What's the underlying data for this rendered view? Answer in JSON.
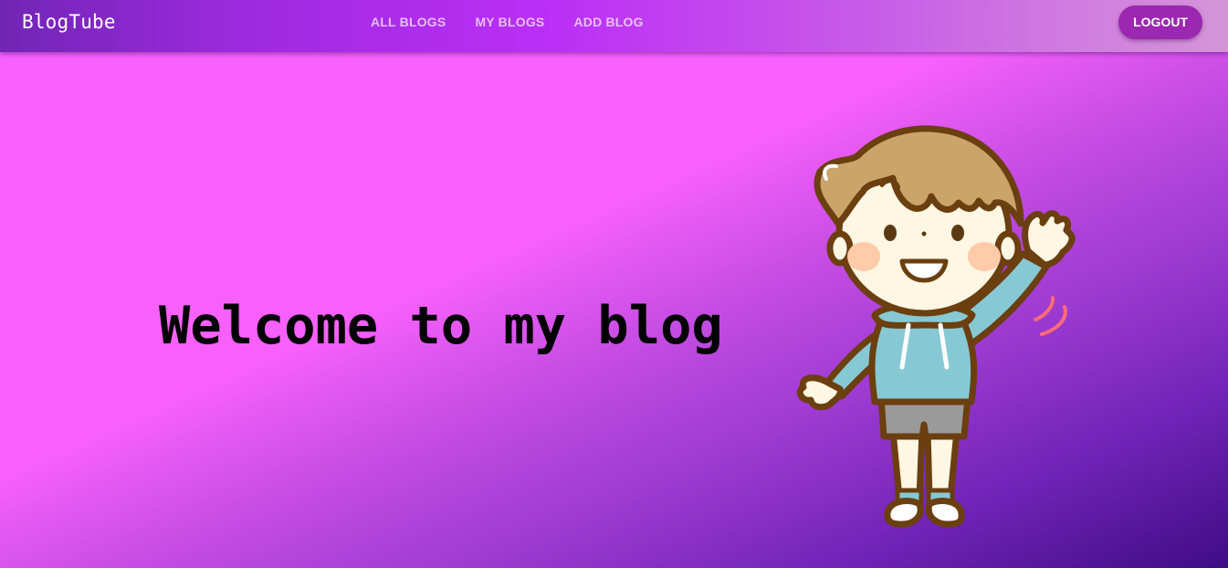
{
  "navbar": {
    "brand": "BlogTube",
    "tabs": [
      {
        "label": "ALL BLOGS"
      },
      {
        "label": "MY BLOGS"
      },
      {
        "label": "ADD BLOG"
      }
    ],
    "logout_label": "LOGOUT"
  },
  "hero": {
    "heading": "Welcome to my blog",
    "illustration": "waving-boy-cartoon"
  },
  "colors": {
    "appbar_start": "#7125b4",
    "appbar_mid": "#bb2ff6",
    "appbar_end": "#d595d9",
    "background_light": "#f760fb",
    "background_dark": "#3e0c86",
    "logout_button": "#9c27b0",
    "nav_text": "rgba(255,255,255,0.68)"
  }
}
